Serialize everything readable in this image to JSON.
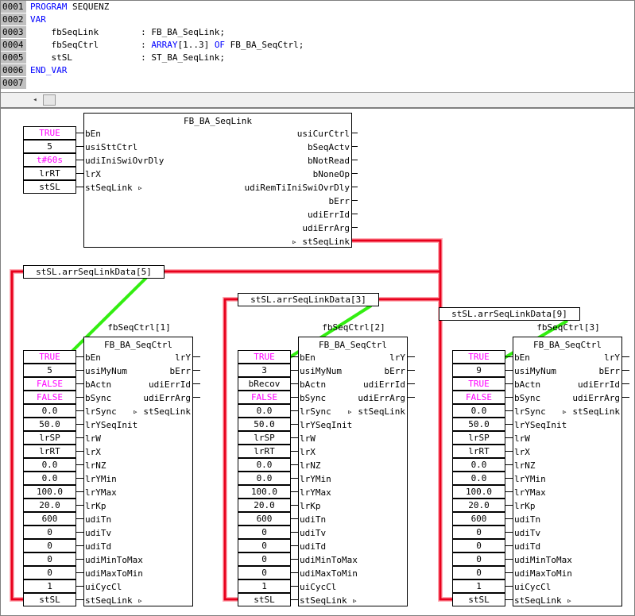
{
  "declaration": {
    "line_numbers": [
      "0001",
      "0002",
      "0003",
      "0004",
      "0005",
      "0006",
      "0007"
    ],
    "lines": [
      {
        "kw": "PROGRAM",
        "rest": " SEQUENZ"
      },
      {
        "kw": "VAR",
        "rest": ""
      },
      {
        "name": "    fbSeqLink",
        "colon": "        : FB_BA_SeqLink;"
      },
      {
        "name": "    fbSeqCtrl",
        "colon_pre": "        : ",
        "kw1": "ARRAY",
        "mid": "[1..3] ",
        "kw2": "OF",
        "end": " FB_BA_SeqCtrl;"
      },
      {
        "name": "    stSL",
        "colon": "             : ST_BA_SeqLink;"
      },
      {
        "kw": "END_VAR",
        "rest": ""
      }
    ],
    "scroll_left_glyph": "◂"
  },
  "seqlink": {
    "type": "FB_BA_SeqLink",
    "inputs": [
      {
        "pin": "bEn",
        "value": "TRUE",
        "pink": true
      },
      {
        "pin": "usiSttCtrl",
        "value": "5",
        "pink": false
      },
      {
        "pin": "udiIniSwiOvrDly",
        "value": "t#60s",
        "pink": true
      },
      {
        "pin": "lrX",
        "value": "lrRT",
        "pink": false
      },
      {
        "pin": "stSeqLink ▹",
        "value": "stSL",
        "pink": false
      }
    ],
    "outputs": [
      "usiCurCtrl",
      "bSeqActv",
      "bNotRead",
      "bNoneOp",
      "udiRemTiIniSwiOvrDly",
      "bErr",
      "udiErrId",
      "udiErrArg",
      "▹ stSeqLink"
    ]
  },
  "data_vars": [
    "stSL.arrSeqLinkData[5]",
    "stSL.arrSeqLinkData[3]",
    "stSL.arrSeqLinkData[9]"
  ],
  "seqctrl_pins": {
    "inputs": [
      "bEn",
      "usiMyNum",
      "bActn",
      "bSync",
      "lrSync",
      "lrYSeqInit",
      "lrW",
      "lrX",
      "lrNZ",
      "lrYMin",
      "lrYMax",
      "lrKp",
      "udiTn",
      "udiTv",
      "udiTd",
      "udiMinToMax",
      "udiMaxToMin",
      "uiCycCl",
      "stSeqLink ▹"
    ],
    "outputs": [
      "lrY",
      "bErr",
      "udiErrId",
      "udiErrArg",
      "▹ stSeqLink"
    ]
  },
  "seqctrls": [
    {
      "instance": "fbSeqCtrl[1]",
      "type": "FB_BA_SeqCtrl",
      "values": [
        "TRUE",
        "5",
        "FALSE",
        "FALSE",
        "0.0",
        "50.0",
        "lrSP",
        "lrRT",
        "0.0",
        "0.0",
        "100.0",
        "20.0",
        "600",
        "0",
        "0",
        "0",
        "0",
        "1",
        "stSL"
      ],
      "pink": [
        true,
        false,
        true,
        true,
        false,
        false,
        false,
        false,
        false,
        false,
        false,
        false,
        false,
        false,
        false,
        false,
        false,
        false,
        false
      ]
    },
    {
      "instance": "fbSeqCtrl[2]",
      "type": "FB_BA_SeqCtrl",
      "values": [
        "TRUE",
        "3",
        "bRecov",
        "FALSE",
        "0.0",
        "50.0",
        "lrSP",
        "lrRT",
        "0.0",
        "0.0",
        "100.0",
        "20.0",
        "600",
        "0",
        "0",
        "0",
        "0",
        "1",
        "stSL"
      ],
      "pink": [
        true,
        false,
        false,
        true,
        false,
        false,
        false,
        false,
        false,
        false,
        false,
        false,
        false,
        false,
        false,
        false,
        false,
        false,
        false
      ]
    },
    {
      "instance": "fbSeqCtrl[3]",
      "type": "FB_BA_SeqCtrl",
      "values": [
        "TRUE",
        "9",
        "TRUE",
        "FALSE",
        "0.0",
        "50.0",
        "lrSP",
        "lrRT",
        "0.0",
        "0.0",
        "100.0",
        "20.0",
        "600",
        "0",
        "0",
        "0",
        "0",
        "1",
        "stSL"
      ],
      "pink": [
        true,
        false,
        true,
        true,
        false,
        false,
        false,
        false,
        false,
        false,
        false,
        false,
        false,
        false,
        false,
        false,
        false,
        false,
        false
      ]
    }
  ],
  "colors": {
    "keyword": "#0000ff",
    "boolean_literal": "#ff00ff",
    "link_wire": "#e8001c",
    "wire_highlight": "#ffb0b8",
    "annotation_line": "#33ee11"
  }
}
